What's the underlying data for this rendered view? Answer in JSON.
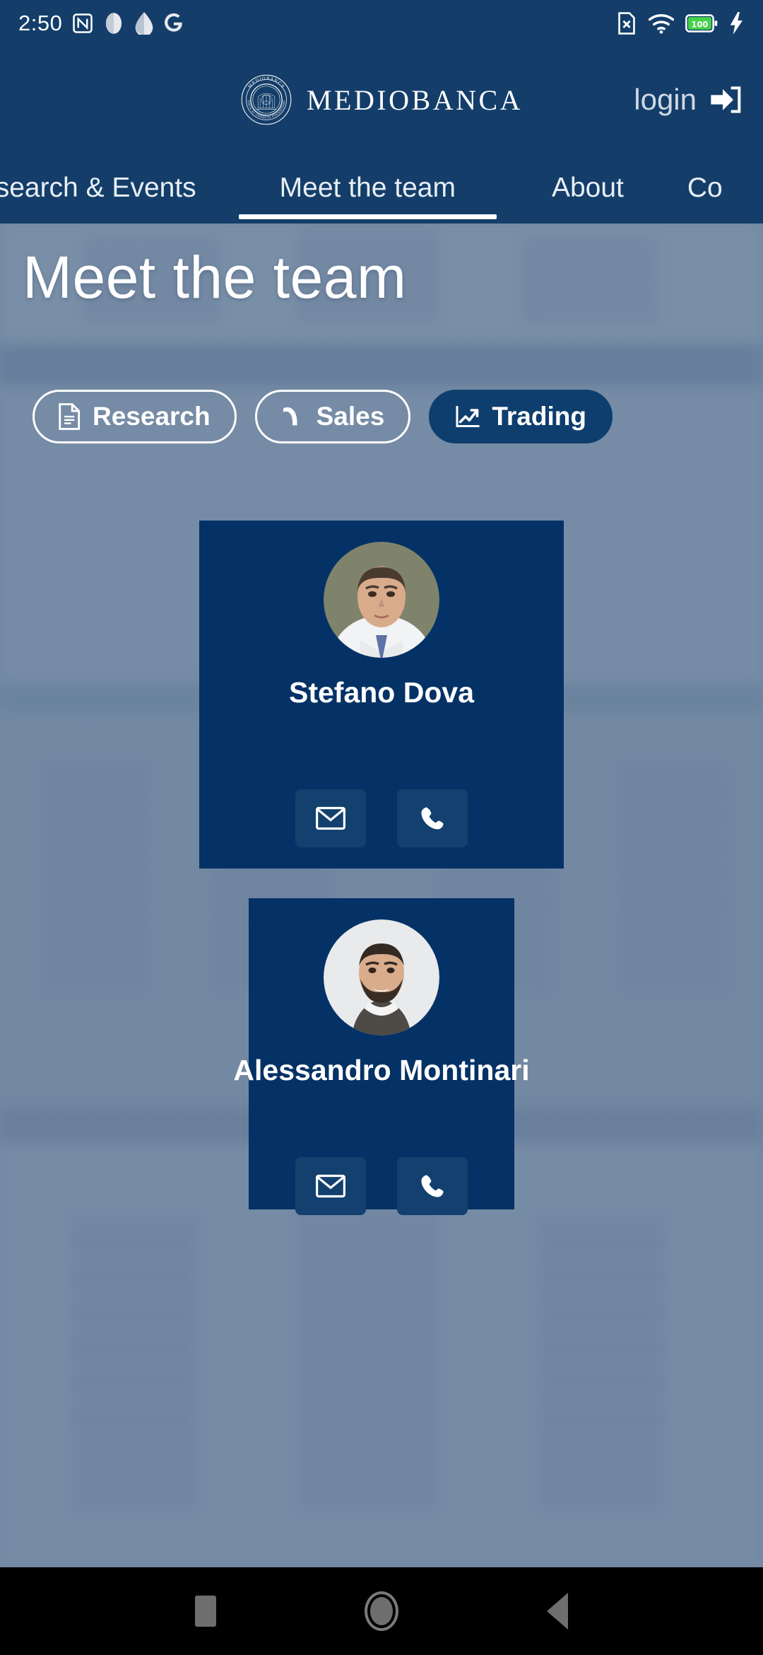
{
  "statusbar": {
    "time": "2:50",
    "left_icons": [
      "nfc-icon",
      "app-icon-half-circle",
      "app-icon-leaf",
      "google-icon"
    ],
    "right_icons": [
      "no-sim-icon",
      "wifi-icon",
      "battery-icon",
      "charging-bolt-icon"
    ],
    "battery_level": "100",
    "background_color": "#143E69"
  },
  "header": {
    "brand_name": "MEDIOBANCA",
    "seal_text_top": "MEDIOBANCA",
    "seal_text_bottom": "BANCA DI CREDITO FINANZIARIO",
    "login_label": "login",
    "login_icon": "sign-in-icon"
  },
  "tabs": [
    {
      "label": "esearch & Events",
      "active": false
    },
    {
      "label": "Meet the team",
      "active": true
    },
    {
      "label": "About",
      "active": false
    },
    {
      "label": "Co",
      "active": false
    }
  ],
  "main": {
    "page_title": "Meet the team",
    "chips": [
      {
        "label": "Research",
        "icon": "document-icon",
        "active": false
      },
      {
        "label": "Sales",
        "icon": "phone-handset-icon",
        "active": false
      },
      {
        "label": "Trading",
        "icon": "line-chart-icon",
        "active": true
      }
    ],
    "people": [
      {
        "name": "Stefano Dova",
        "avatar": "portrait-man-suit-tie",
        "email_icon": "envelope-icon",
        "phone_icon": "phone-icon"
      },
      {
        "name": "Alessandro Montinari",
        "avatar": "portrait-man-beard-jacket",
        "email_icon": "envelope-icon",
        "phone_icon": "phone-icon"
      }
    ]
  },
  "navbar": {
    "buttons": [
      "recents-icon",
      "home-icon",
      "back-icon"
    ]
  },
  "colors": {
    "brand_blue": "#143E69",
    "card_blue": "#043266",
    "chip_active": "#0e3e6e",
    "contact_btn": "#13406e",
    "page_bg": "#70869f",
    "navbar": "#000000"
  }
}
